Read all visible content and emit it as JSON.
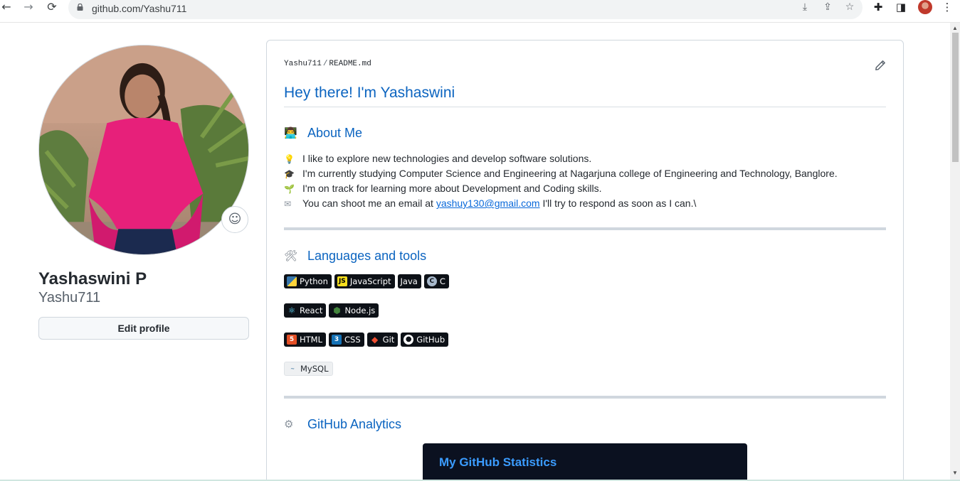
{
  "browser": {
    "url": "github.com/Yashu711",
    "back_icon": "arrow-left-icon",
    "forward_icon": "arrow-right-icon",
    "reload_icon": "reload-icon"
  },
  "profile": {
    "full_name": "Yashaswini P",
    "username": "Yashu711",
    "edit_label": "Edit profile"
  },
  "readme": {
    "breadcrumb_user": "Yashu711",
    "breadcrumb_sep": "/",
    "breadcrumb_file": "README.md",
    "heading": "Hey there! I'm Yashaswini",
    "about": {
      "heading": "About Me",
      "lines": [
        {
          "text": "I like to explore new technologies and develop software solutions."
        },
        {
          "text": "I'm currently studying Computer Science and Engineering at Nagarjuna college of Engineering and Technology, Banglore."
        },
        {
          "text": "I'm on track for learning more about Development and Coding skills."
        }
      ],
      "email_prefix": "You can shoot me an email at",
      "email": "yashuy130@gmail.com",
      "email_suffix": "I'll try to respond as soon as I can.\\"
    },
    "languages": {
      "heading": "Languages and tools",
      "row1": [
        "Python",
        "JavaScript",
        "Java",
        "C"
      ],
      "row2": [
        "React",
        "Node.js"
      ],
      "row3": [
        "HTML",
        "CSS",
        "Git",
        "GitHub"
      ],
      "row4": [
        "MySQL"
      ]
    },
    "analytics": {
      "heading": "GitHub Analytics",
      "stats_title": "My GitHub Statistics"
    }
  },
  "colors": {
    "link": "#0b64c0",
    "badge_bg": "#0d1117",
    "stats_bg": "#0b1120",
    "stats_title": "#3b9cff"
  }
}
